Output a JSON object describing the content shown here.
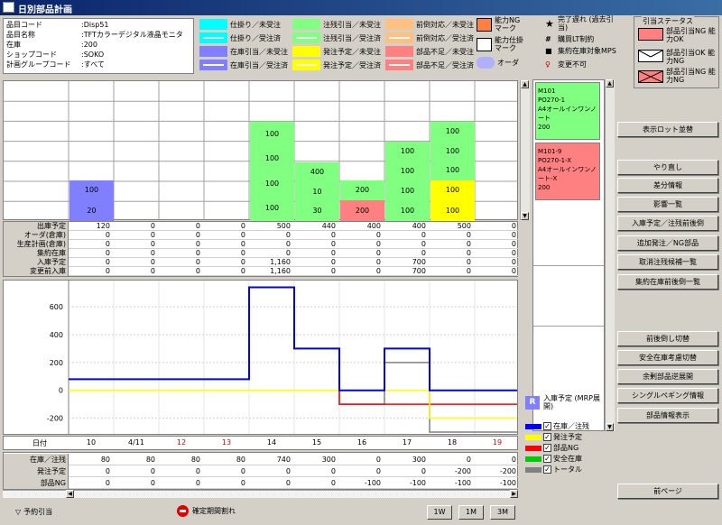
{
  "window": {
    "title": "日別部品計画"
  },
  "info": [
    {
      "k": "品目コード",
      "v": ":Disp51"
    },
    {
      "k": "品目名称",
      "v": ":TFTカラーデジタル液晶モニタ"
    },
    {
      "k": "在庫",
      "v": ":200"
    },
    {
      "k": "ショップコード",
      "v": ":SOKO"
    },
    {
      "k": "計画グループコード",
      "v": ":すべて"
    }
  ],
  "legend": [
    {
      "label": "仕掛り／未受注",
      "color": "#00ffff",
      "line": false
    },
    {
      "label": "仕掛り／受注済",
      "color": "#00ffff",
      "line": true
    },
    {
      "label": "在庫引当／未受注",
      "color": "#8080ff",
      "line": false
    },
    {
      "label": "在庫引当／受注済",
      "color": "#8080ff",
      "line": true
    },
    {
      "label": "注残引当／未受注",
      "color": "#80ff80",
      "line": false
    },
    {
      "label": "注残引当／受注済",
      "color": "#80ff80",
      "line": true
    },
    {
      "label": "発注予定／未受注",
      "color": "#ffff00",
      "line": false
    },
    {
      "label": "発注予定／受注済",
      "color": "#ffff00",
      "line": true
    },
    {
      "label": "前倒対応／未受注",
      "color": "#ffc080",
      "line": false
    },
    {
      "label": "前倒対応／受注済",
      "color": "#ffc080",
      "line": true
    },
    {
      "label": "部品不足／未受注",
      "color": "#ff8080",
      "line": false
    },
    {
      "label": "部品不足／受注済",
      "color": "#ff8080",
      "line": true
    }
  ],
  "markers": {
    "ng": "能力NG マーク",
    "shikake": "能力仕掛 マーク",
    "order": "オーダ",
    "kanryo": "完了遅れ (過去引当)",
    "lt": "購買LT制約",
    "mps": "集約在庫対象MPS",
    "fuka": "変更不可"
  },
  "status": {
    "caption": "引当ステータス",
    "items": [
      {
        "label": "部品引当NG 能力OK",
        "color": "#ff8080"
      },
      {
        "label": "部品引当OK 能力NG",
        "color": "#ffffff"
      },
      {
        "label": "部品引当NG 能力NG",
        "color": "#ff8080"
      }
    ]
  },
  "blocks": [
    {
      "col": 0,
      "top": 110,
      "h": 45,
      "color": "#8080ff",
      "labels": [
        "100",
        "20"
      ]
    },
    {
      "col": 4,
      "top": 45,
      "h": 110,
      "color": "#80ff80",
      "labels": [
        "100",
        "100",
        "100",
        "100"
      ]
    },
    {
      "col": 5,
      "top": 90,
      "h": 65,
      "color": "#80ff80",
      "labels": [
        "400",
        "10",
        "30"
      ]
    },
    {
      "col": 6,
      "top": 110,
      "h": 22,
      "color": "#80ff80",
      "labels": [
        "200"
      ]
    },
    {
      "col": 6,
      "top": 132,
      "h": 23,
      "color": "#ff8080",
      "labels": [
        "200"
      ]
    },
    {
      "col": 7,
      "top": 67,
      "h": 88,
      "color": "#80ff80",
      "labels": [
        "100",
        "100",
        "100",
        "100"
      ]
    },
    {
      "col": 8,
      "top": 45,
      "h": 65,
      "color": "#80ff80",
      "labels": [
        "100",
        "100",
        "100"
      ]
    },
    {
      "col": 8,
      "top": 110,
      "h": 45,
      "color": "#ffff00",
      "labels": [
        "100",
        "100"
      ]
    }
  ],
  "num_rows": [
    {
      "label": "出庫予定",
      "values": [
        "120",
        "0",
        "0",
        "0",
        "500",
        "440",
        "400",
        "400",
        "500",
        "0"
      ]
    },
    {
      "label": "オーダ(倉庫)",
      "values": [
        "0",
        "0",
        "0",
        "0",
        "0",
        "0",
        "0",
        "0",
        "0",
        "0"
      ]
    },
    {
      "label": "生産計画(倉庫)",
      "values": [
        "0",
        "0",
        "0",
        "0",
        "0",
        "0",
        "0",
        "0",
        "0",
        "0"
      ]
    },
    {
      "label": "集約在庫",
      "values": [
        "0",
        "0",
        "0",
        "0",
        "0",
        "0",
        "0",
        "0",
        "0",
        "0"
      ]
    },
    {
      "label": "入庫予定",
      "values": [
        "0",
        "0",
        "0",
        "0",
        "1,160",
        "0",
        "0",
        "700",
        "0",
        "0"
      ]
    },
    {
      "label": "変更前入庫",
      "values": [
        "0",
        "0",
        "0",
        "0",
        "1,160",
        "0",
        "0",
        "700",
        "0",
        "0"
      ]
    }
  ],
  "dates": {
    "label": "日付",
    "items": [
      {
        "t": "10",
        "red": false
      },
      {
        "t": "4/11",
        "red": false
      },
      {
        "t": "12",
        "red": true
      },
      {
        "t": "13",
        "red": true
      },
      {
        "t": "14",
        "red": false
      },
      {
        "t": "15",
        "red": false
      },
      {
        "t": "16",
        "red": false
      },
      {
        "t": "17",
        "red": false
      },
      {
        "t": "18",
        "red": false
      },
      {
        "t": "19",
        "red": true
      }
    ]
  },
  "bottom_rows": [
    {
      "label": "在庫／注残",
      "values": [
        "80",
        "80",
        "80",
        "80",
        "740",
        "300",
        "0",
        "300",
        "0",
        "0"
      ]
    },
    {
      "label": "発注予定",
      "values": [
        "0",
        "0",
        "0",
        "0",
        "0",
        "0",
        "0",
        "0",
        "-200",
        "-200"
      ]
    },
    {
      "label": "部品NG",
      "values": [
        "0",
        "0",
        "0",
        "0",
        "0",
        "0",
        "-100",
        "-100",
        "-100",
        "-100"
      ]
    }
  ],
  "chart_data": {
    "type": "line",
    "x": [
      "10",
      "4/11",
      "12",
      "13",
      "14",
      "15",
      "16",
      "17",
      "18",
      "19"
    ],
    "ylim": [
      -300,
      750
    ],
    "yticks": [
      "600",
      "400",
      "200",
      "0",
      "-200"
    ],
    "series": [
      {
        "name": "在庫／注残",
        "color": "#0000ff",
        "values": [
          80,
          80,
          80,
          80,
          740,
          300,
          0,
          300,
          0,
          0
        ]
      },
      {
        "name": "発注予定",
        "color": "#ffff00",
        "values": [
          0,
          0,
          0,
          0,
          0,
          0,
          0,
          0,
          -200,
          -200
        ]
      },
      {
        "name": "部品NG",
        "color": "#ff0000",
        "values": [
          0,
          0,
          0,
          0,
          0,
          0,
          -100,
          -100,
          -100,
          -100
        ]
      },
      {
        "name": "安全在庫",
        "color": "#00cc00",
        "values": [
          0,
          0,
          0,
          0,
          0,
          0,
          0,
          0,
          0,
          0
        ]
      },
      {
        "name": "トータル",
        "color": "#808080",
        "values": [
          80,
          80,
          80,
          80,
          740,
          300,
          -100,
          200,
          -300,
          -300
        ]
      }
    ]
  },
  "nyuko": "入庫予定 (MRP展開)",
  "checks": [
    {
      "label": "在庫／注残",
      "color": "#0000ff"
    },
    {
      "label": "発注予定",
      "color": "#ffff00"
    },
    {
      "label": "部品NG",
      "color": "#ff0000"
    },
    {
      "label": "安全在庫",
      "color": "#00cc00"
    },
    {
      "label": "トータル",
      "color": "#808080"
    }
  ],
  "lots": [
    {
      "lines": [
        "M101",
        "PO270-1",
        "A4オールインワンノート",
        "200"
      ],
      "color": "#80ff80"
    },
    {
      "lines": [
        "M101-9",
        "PO270-1-X",
        "A4オールインワンノート-X",
        "200"
      ],
      "color": "#ff8080"
    }
  ],
  "buttons": [
    "表示ロット並替",
    "やり直し",
    "差分情報",
    "影響一覧",
    "入庫予定／注残前後倒",
    "追加発注／NG部品",
    "取消注残候補一覧",
    "集約在庫前後倒一覧",
    "前後倒し切替",
    "安全在庫考慮切替",
    "余剰部品逆展開",
    "シングルペギング情報",
    "部品情報表示",
    "前ページ"
  ],
  "footer": {
    "yoyaku": "予約引当",
    "kakutei": "確定期間割れ",
    "w1": "1W",
    "m1": "1M",
    "m3": "3M"
  }
}
